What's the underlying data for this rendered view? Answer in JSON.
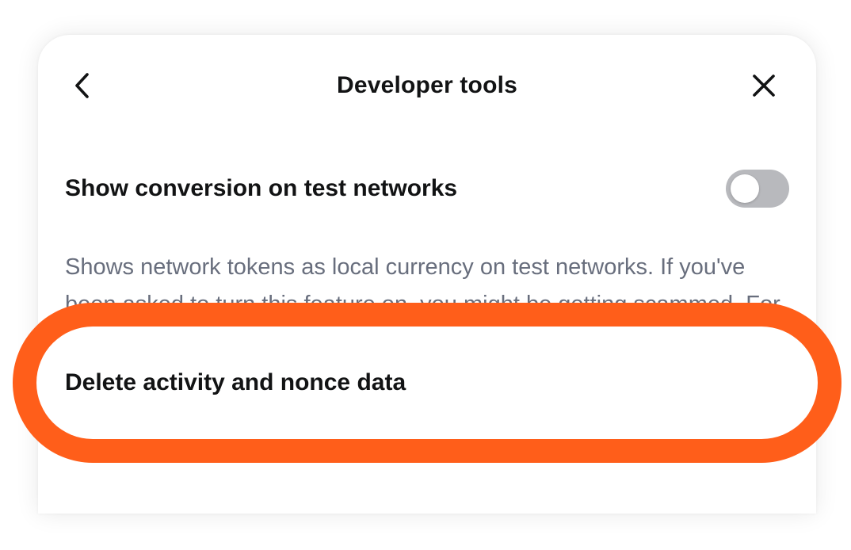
{
  "header": {
    "title": "Developer tools",
    "back_icon": "chevron-left-icon",
    "close_icon": "close-icon"
  },
  "settings": {
    "show_conversion": {
      "label": "Show conversion on test networks",
      "description": "Shows network tokens as local currency on test networks. If you've been asked to turn this feature on, you might be getting scammed. For testing purposes only. Learn more",
      "enabled": false
    },
    "delete_activity": {
      "label": "Delete activity and nonce data"
    }
  },
  "colors": {
    "highlight": "#ff5e1a",
    "toggle_off": "#b8b9bd",
    "text_primary": "#121314",
    "text_secondary": "#686e7d"
  }
}
